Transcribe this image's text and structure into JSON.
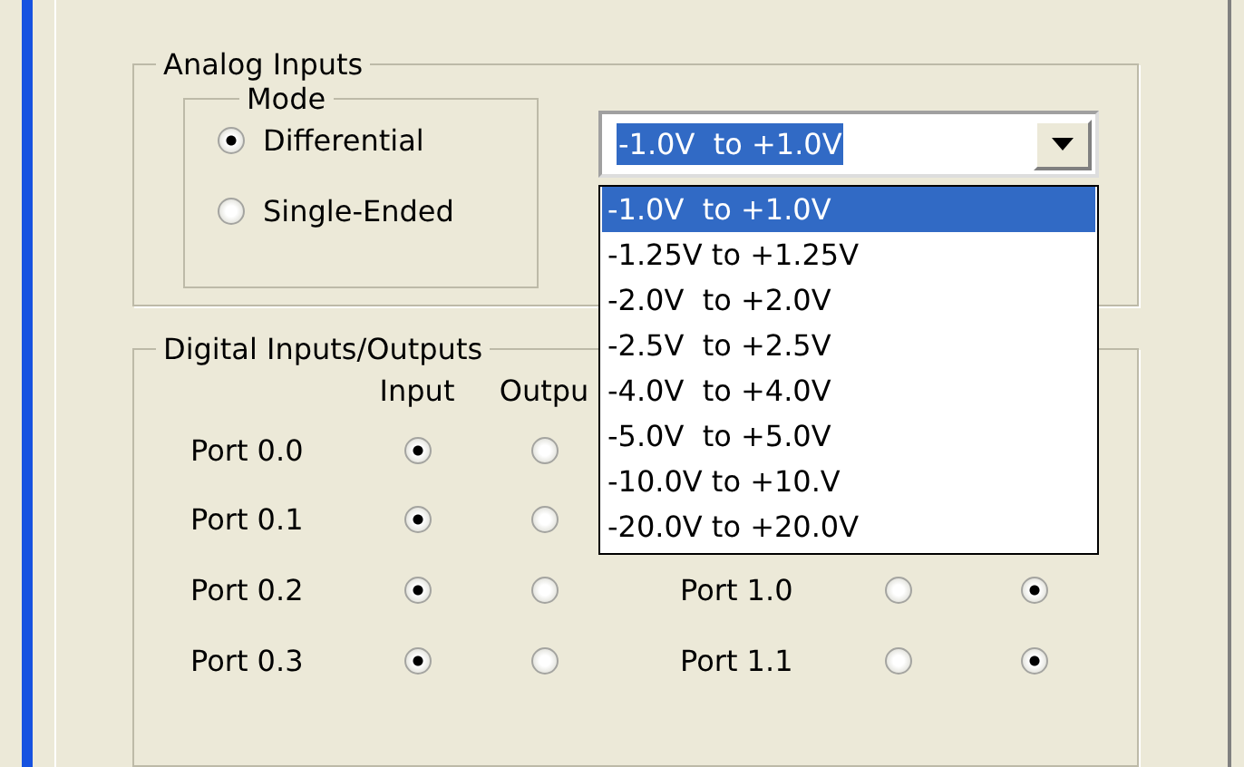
{
  "analog_inputs": {
    "title": "Analog Inputs",
    "mode": {
      "title": "Mode",
      "options": [
        {
          "label": "Differential",
          "selected": true
        },
        {
          "label": "Single-Ended",
          "selected": false
        }
      ]
    },
    "range": {
      "value": "-1.0V  to +1.0V",
      "expanded": true,
      "options": [
        {
          "label": "-1.0V  to +1.0V",
          "selected": true
        },
        {
          "label": "-1.25V to +1.25V",
          "selected": false
        },
        {
          "label": "-2.0V  to +2.0V",
          "selected": false
        },
        {
          "label": "-2.5V  to +2.5V",
          "selected": false
        },
        {
          "label": "-4.0V  to +4.0V",
          "selected": false
        },
        {
          "label": "-5.0V  to +5.0V",
          "selected": false
        },
        {
          "label": "-10.0V to +10.V",
          "selected": false
        },
        {
          "label": "-20.0V to +20.0V",
          "selected": false
        }
      ]
    }
  },
  "digital_io": {
    "title": "Digital Inputs/Outputs",
    "columns": [
      "Input",
      "Outpu"
    ],
    "rows": [
      {
        "left": {
          "label": "Port 0.0",
          "options": [
            {
              "selected": true
            },
            {
              "selected": false
            }
          ]
        }
      },
      {
        "left": {
          "label": "Port 0.1",
          "options": [
            {
              "selected": true
            },
            {
              "selected": false
            }
          ]
        }
      },
      {
        "left": {
          "label": "Port 0.2",
          "options": [
            {
              "selected": true
            },
            {
              "selected": false
            }
          ]
        },
        "right": {
          "label": "Port 1.0",
          "options": [
            {
              "selected": false
            },
            {
              "selected": true
            }
          ]
        }
      },
      {
        "left": {
          "label": "Port 0.3",
          "options": [
            {
              "selected": true
            },
            {
              "selected": false
            }
          ]
        },
        "right": {
          "label": "Port 1.1",
          "options": [
            {
              "selected": false
            },
            {
              "selected": true
            }
          ]
        }
      }
    ]
  }
}
